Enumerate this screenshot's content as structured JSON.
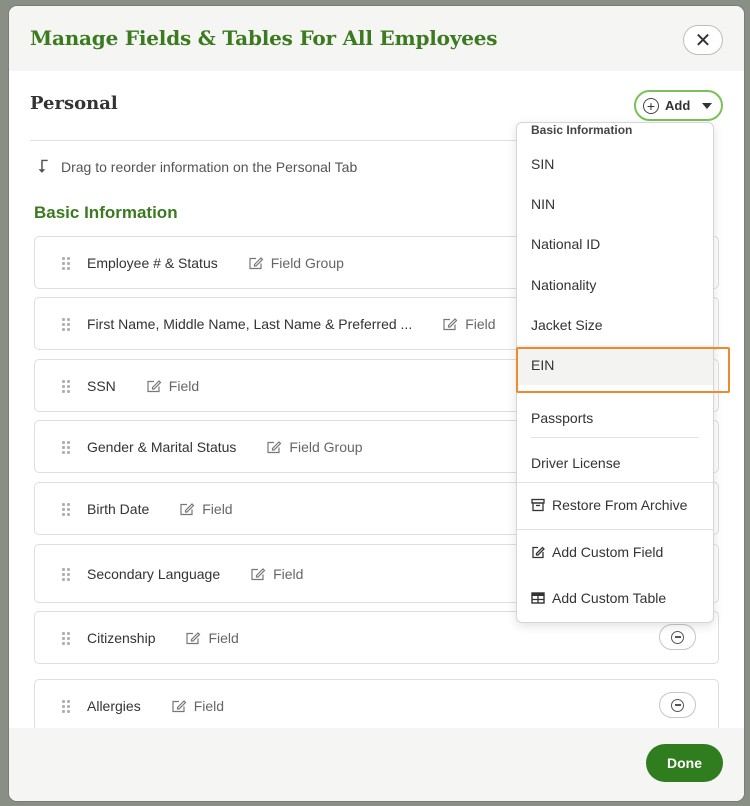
{
  "modal": {
    "title": "Manage Fields & Tables For All Employees",
    "close_label": "✕"
  },
  "section": {
    "title": "Personal",
    "add_label": "Add",
    "hint": "Drag to reorder information on the Personal Tab",
    "group_title": "Basic Information"
  },
  "rows": [
    {
      "label": "Employee # & Status",
      "type": "Field Group",
      "removable": false
    },
    {
      "label": "First Name, Middle Name, Last Name & Preferred ...",
      "type": "Field",
      "removable": false
    },
    {
      "label": "SSN",
      "type": "Field",
      "removable": false
    },
    {
      "label": "Gender & Marital Status",
      "type": "Field Group",
      "removable": false
    },
    {
      "label": "Birth Date",
      "type": "Field",
      "removable": false
    },
    {
      "label": "Secondary Language",
      "type": "Field",
      "removable": false
    },
    {
      "label": "Citizenship",
      "type": "Field",
      "removable": true
    },
    {
      "label": "Allergies",
      "type": "Field",
      "removable": true
    }
  ],
  "dropdown": {
    "header": "Basic Information",
    "items": [
      "SIN",
      "NIN",
      "National ID",
      "Nationality",
      "Jacket Size",
      "EIN"
    ],
    "selected": "EIN",
    "passports": "Passports",
    "driver_license": "Driver License",
    "restore": "Restore From Archive",
    "add_field": "Add Custom Field",
    "add_table": "Add Custom Table"
  },
  "footer": {
    "done_label": "Done"
  },
  "colors": {
    "brand_green": "#3b7a1f",
    "done_green": "#2f7d1e",
    "highlight_orange": "#ec8a2e"
  }
}
